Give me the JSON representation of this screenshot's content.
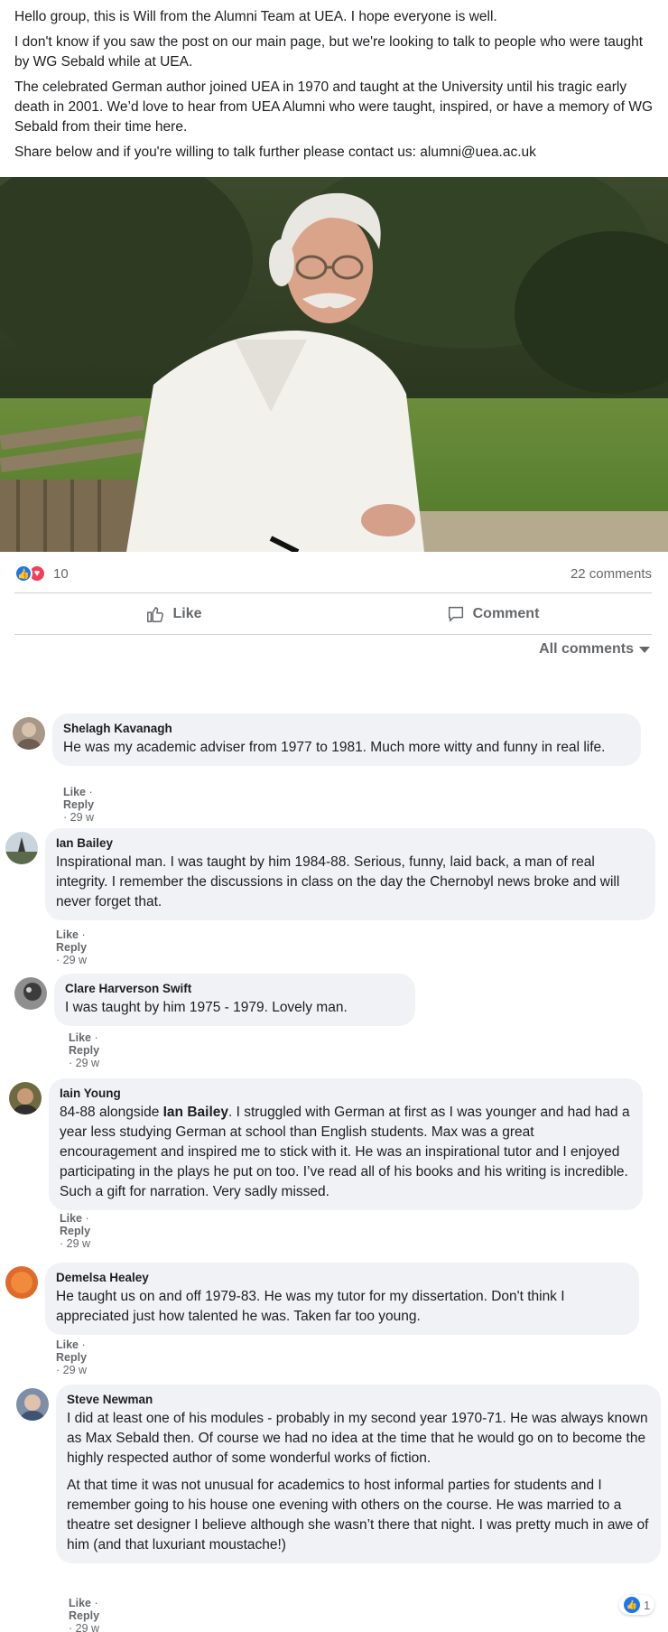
{
  "post": {
    "paragraphs": [
      "Hello group, this is Will from the Alumni Team at UEA. I hope everyone is well.",
      "I don't know if you saw the post on our main page, but we're looking to talk to people who were taught by WG Sebald while at UEA.",
      "The celebrated German author joined UEA in 1970 and taught at the University until his tragic early death in 2001. We’d love to hear from UEA Alumni who were taught, inspired, or have a memory of WG Sebald from their time here.",
      "Share below and if you're willing to talk further please contact us: alumni@uea.ac.uk"
    ],
    "reaction_count": "10",
    "comment_count": "22 comments"
  },
  "actions": {
    "like": "Like",
    "comment": "Comment"
  },
  "comments_filter": "All comments",
  "comments": [
    {
      "name": "Shelagh Kavanagh",
      "paragraphs": [
        "He was my academic adviser from 1977 to 1981. Much more witty and funny in real life."
      ],
      "like": "Like",
      "reply": "Reply",
      "time": "29 w"
    },
    {
      "name": "Ian Bailey",
      "paragraphs": [
        "Inspirational man. I was taught by him 1984-88. Serious, funny, laid back, a man of real integrity. I remember the discussions in class on the day the Chernobyl news broke and will never forget that."
      ],
      "like": "Like",
      "reply": "Reply",
      "time": "29 w"
    },
    {
      "name": "Clare Harverson Swift",
      "paragraphs": [
        "I was taught by him 1975 - 1979. Lovely man."
      ],
      "like": "Like",
      "reply": "Reply",
      "time": "29 w"
    },
    {
      "name": "Iain Young",
      "prefix": "84-88 alongside ",
      "mention": "Ian Bailey",
      "paragraphs": [
        ". I struggled with German at first as I was younger and had had a year less studying German at school than English students. Max was a great encouragement and inspired me to stick with it. He was an inspirational tutor and I enjoyed participating in the plays he put on too. I’ve read all of his books and his writing is incredible. Such a gift for narration. Very sadly missed."
      ],
      "like": "Like",
      "reply": "Reply",
      "time": "29 w"
    },
    {
      "name": "Demelsa Healey",
      "paragraphs": [
        "He taught us on and off 1979-83. He was my tutor for my dissertation. Don't think I appreciated just how talented he was. Taken far too young."
      ],
      "like": "Like",
      "reply": "Reply",
      "time": "29 w"
    },
    {
      "name": "Steve Newman",
      "paragraphs": [
        "I did at least one of his modules - probably in my second year 1970-71. He was always known as Max Sebald then. Of course we had no idea at the time that he would go on to become the highly respected author of some wonderful works of fiction.",
        "At that time it was not unusual for academics to host informal parties for students and I remember going to his house one evening with others on the course. He was married to a theatre set designer I believe although she wasn’t there that night. I was pretty much in awe of him (and that luxuriant moustache!)"
      ],
      "like": "Like",
      "reply": "Reply",
      "time": "29 w",
      "like_count": "1"
    }
  ]
}
